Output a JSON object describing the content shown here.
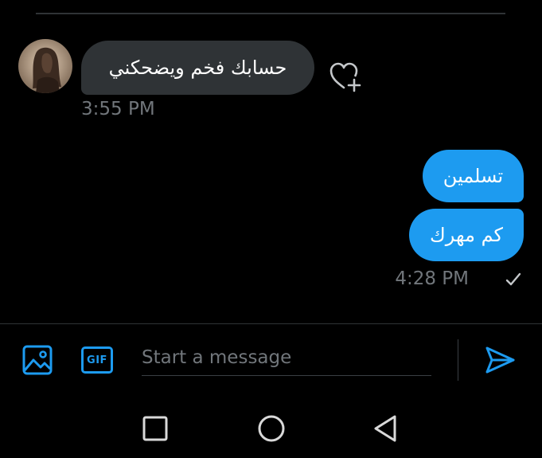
{
  "conversation": {
    "incoming": {
      "text": "حسابك فخم ويضحكني",
      "time": "3:55 PM"
    },
    "outgoing": [
      {
        "text": "تسلمين"
      },
      {
        "text": "كم مهرك"
      }
    ],
    "outgoing_time": "4:28 PM"
  },
  "composer": {
    "placeholder": "Start a message",
    "value": "",
    "gif_label": "GIF"
  },
  "icons": {
    "like": "heart-plus-icon",
    "read": "checkmark-icon",
    "media": "image-icon",
    "send": "send-icon",
    "nav": [
      "recent-apps-icon",
      "home-icon",
      "back-icon"
    ]
  },
  "colors": {
    "background": "#000000",
    "accent": "#1d9bf0",
    "incoming_bubble": "#2f3336",
    "muted_text": "#71767b"
  }
}
